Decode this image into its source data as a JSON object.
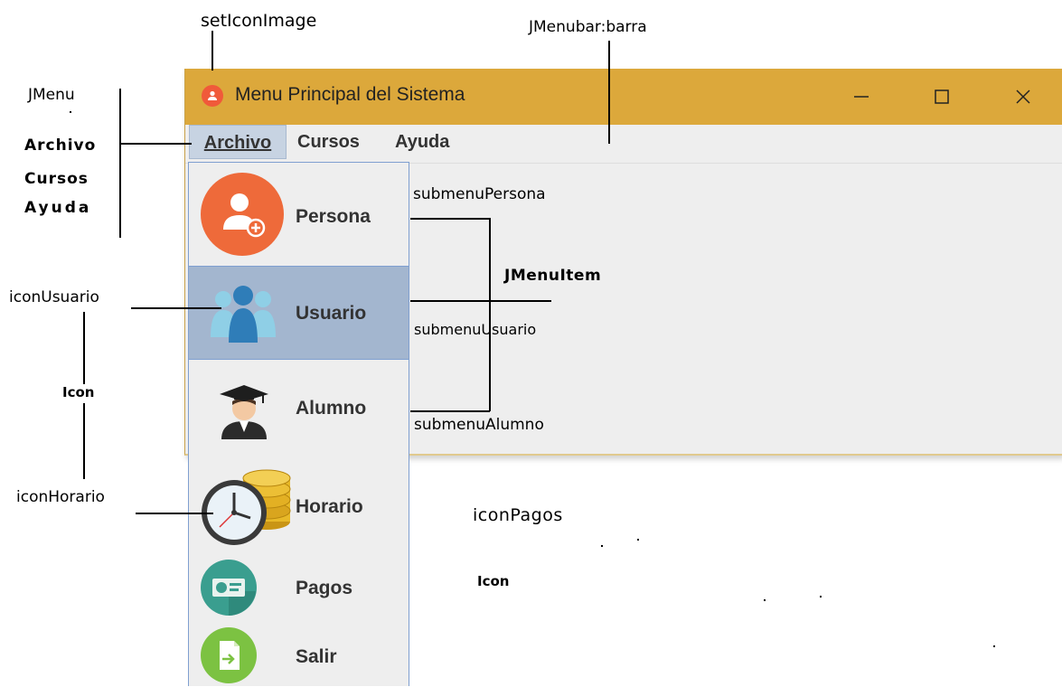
{
  "window": {
    "title": "Menu Principal del Sistema",
    "controls": {
      "minimize": "—",
      "maximize": "☐",
      "close": "✕"
    },
    "titlebar_color": "#dca83b"
  },
  "menubar": [
    {
      "label": "Archivo",
      "active": true
    },
    {
      "label": "Cursos",
      "active": false
    },
    {
      "label": "Ayuda",
      "active": false
    }
  ],
  "dropdown": {
    "items": [
      {
        "label": "Persona",
        "icon": "person-add-icon"
      },
      {
        "label": "Usuario",
        "icon": "users-icon",
        "selected": true
      },
      {
        "label": "Alumno",
        "icon": "graduate-icon"
      },
      {
        "label": "Horario",
        "icon": "clock-coins-icon"
      },
      {
        "label": "Pagos",
        "icon": "money-icon"
      },
      {
        "label": "Salir",
        "icon": "exit-icon"
      }
    ]
  },
  "annotations": {
    "set_icon_image": "setIconImage",
    "jmenubar": "JMenubar:barra",
    "jmenu": "JMenu",
    "archivo": "Archivo",
    "cursos": "Cursos",
    "ayuda": "Ayuda",
    "icon_usuario": "iconUsuario",
    "icon_1": "Icon",
    "icon_horario": "iconHorario",
    "submenu_persona": "submenuPersona",
    "jmenuitem": "JMenuItem",
    "submenu_usuario": "submenuUsuario",
    "submenu_alumno": "submenuAlumno",
    "icon_pagos": "iconPagos",
    "icon_2": "Icon"
  }
}
